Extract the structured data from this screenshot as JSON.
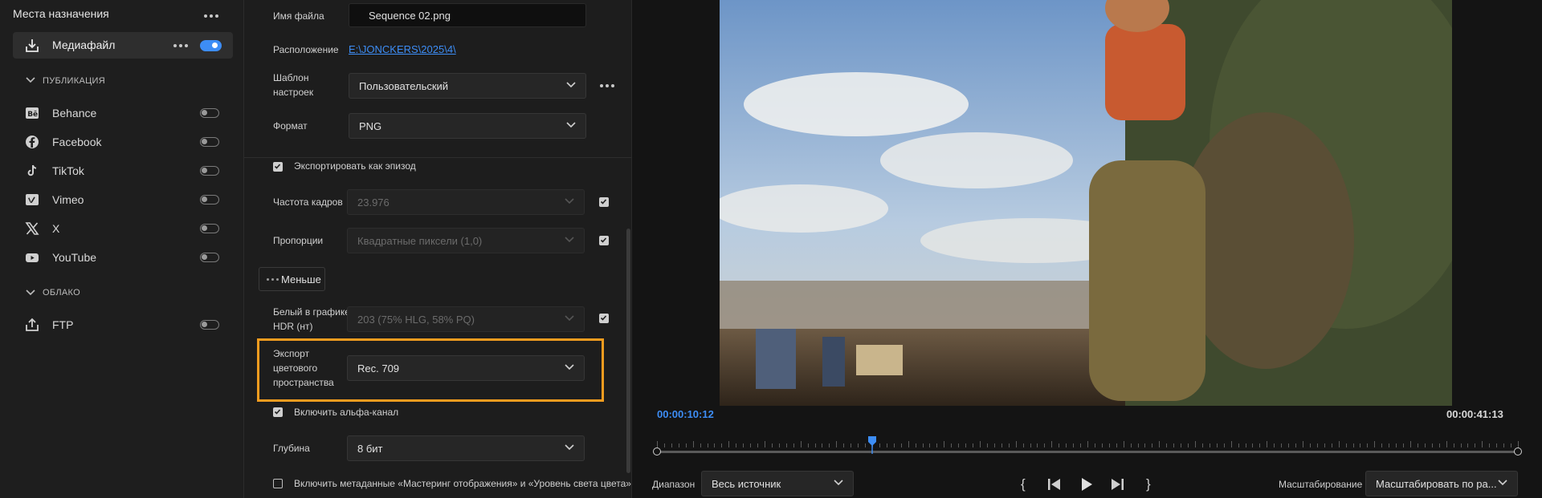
{
  "left": {
    "title": "Места назначения",
    "media": {
      "label": "Медиафайл",
      "enabled": true
    },
    "publication": {
      "header": "ПУБЛИКАЦИЯ",
      "items": [
        {
          "label": "Behance",
          "icon": "behance-icon",
          "enabled": false
        },
        {
          "label": "Facebook",
          "icon": "facebook-icon",
          "enabled": false
        },
        {
          "label": "TikTok",
          "icon": "tiktok-icon",
          "enabled": false
        },
        {
          "label": "Vimeo",
          "icon": "vimeo-icon",
          "enabled": false
        },
        {
          "label": "X",
          "icon": "x-icon",
          "enabled": false
        },
        {
          "label": "YouTube",
          "icon": "youtube-icon",
          "enabled": false
        }
      ]
    },
    "cloud": {
      "header": "ОБЛАКО",
      "items": [
        {
          "label": "FTP",
          "icon": "upload-icon",
          "enabled": false
        }
      ]
    }
  },
  "settings": {
    "filename": {
      "label": "Имя файла",
      "value": "Sequence 02.png"
    },
    "location": {
      "label": "Расположение",
      "value": "E:\\JONCKERS\\2025\\4\\"
    },
    "preset": {
      "label_line1": "Шаблон",
      "label_line2": "настроек",
      "value": "Пользовательский"
    },
    "format": {
      "label": "Формат",
      "value": "PNG"
    },
    "export_as_sequence": {
      "label": "Экспортировать как эпизод",
      "checked": true
    },
    "frame_rate": {
      "label": "Частота кадров",
      "value": "23.976",
      "match_checked": true
    },
    "aspect": {
      "label": "Пропорции",
      "value": "Квадратные пиксели (1,0)",
      "match_checked": true
    },
    "less_button": "Меньше",
    "hdr_white": {
      "label_line1": "Белый в графике",
      "label_line2": "HDR (нт)",
      "value": "203 (75% HLG, 58% PQ)",
      "match_checked": true
    },
    "color_space": {
      "label_line1": "Экспорт",
      "label_line2": "цветового",
      "label_line3": "пространства",
      "value": "Rec. 709"
    },
    "alpha": {
      "label": "Включить альфа-канал",
      "checked": true
    },
    "depth": {
      "label": "Глубина",
      "value": "8 бит"
    },
    "metadata": {
      "label": "Включить метаданные «Мастеринг отображения» и «Уровень света цвета»",
      "checked": false
    }
  },
  "preview": {
    "timecode_current": "00:00:10:12",
    "timecode_total": "00:00:41:13",
    "playhead_progress": 0.25,
    "range_label": "Диапазон",
    "range_value": "Весь источник",
    "scale_label": "Масштабирование",
    "scale_value": "Масштабировать по ра...",
    "accent_color": "#3d8df5",
    "highlight_color": "#f29c1f"
  }
}
